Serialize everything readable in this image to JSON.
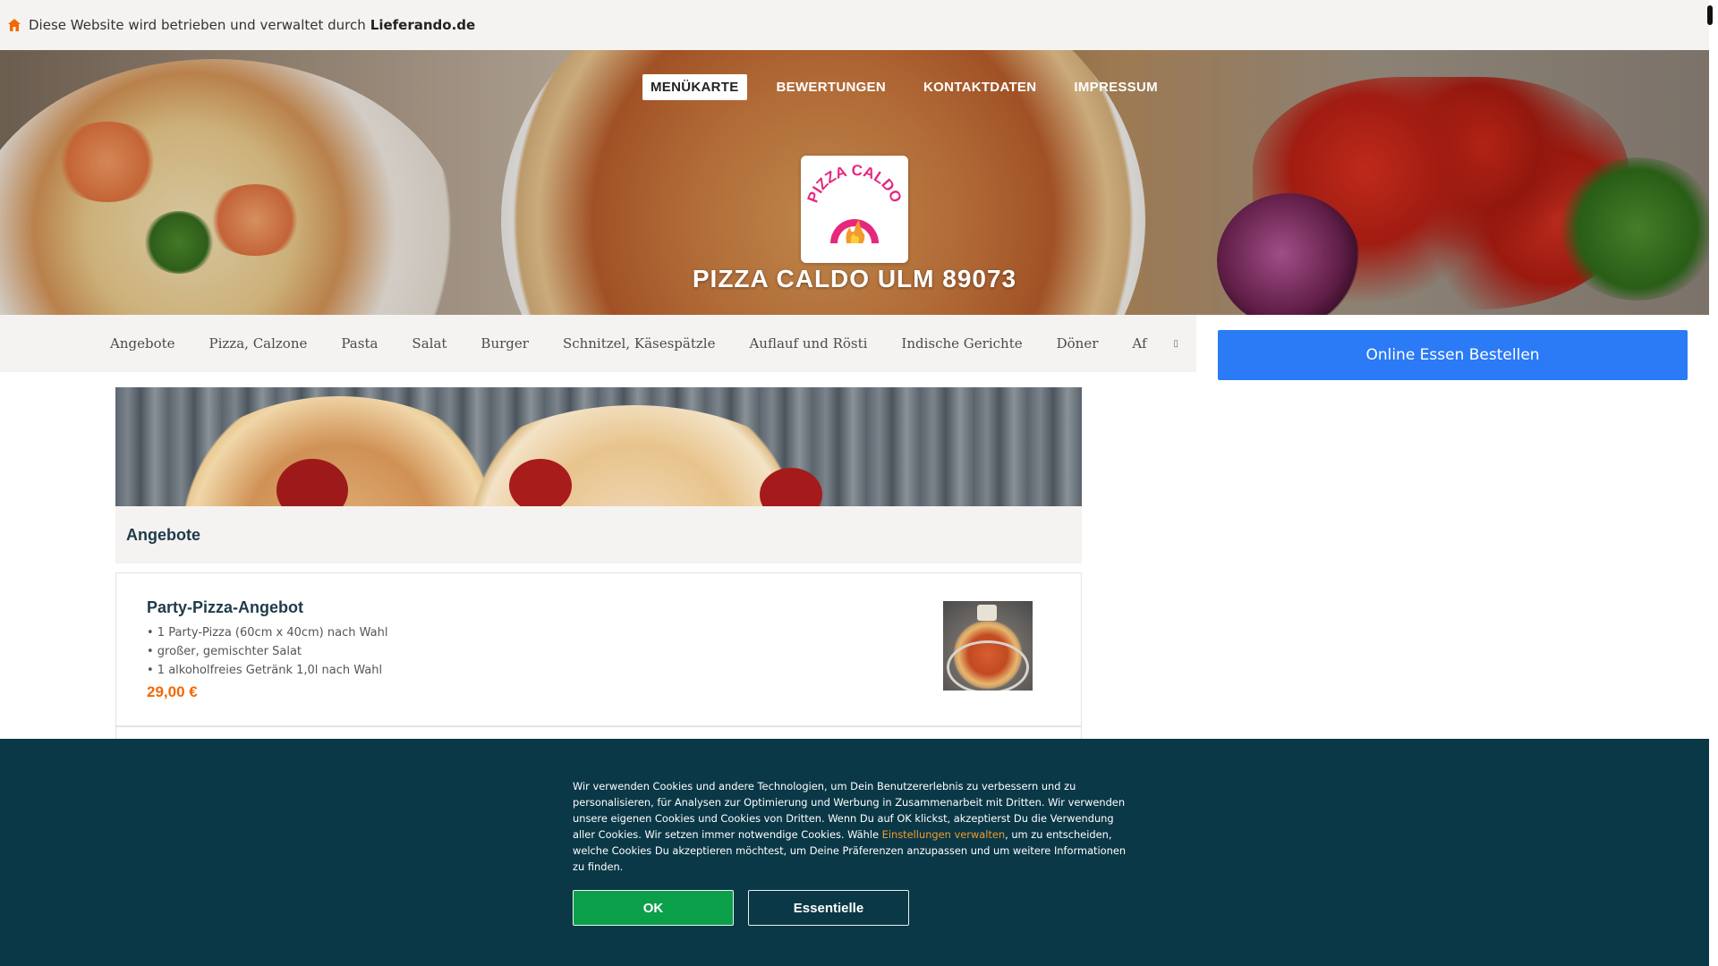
{
  "notice": {
    "prefix": "Diese Website wird betrieben und verwaltet durch",
    "brand": "Lieferando.de",
    "icon": "house-icon"
  },
  "hero": {
    "nav": [
      "MENÜKARTE",
      "BEWERTUNGEN",
      "KONTAKTDATEN",
      "IMPRESSUM"
    ],
    "active_nav": "MENÜKARTE",
    "logo_text": "PIZZA CALDO",
    "title": "PIZZA CALDO ULM 89073"
  },
  "categories": [
    "Angebote",
    "Pizza, Calzone",
    "Pasta",
    "Salat",
    "Burger",
    "Schnitzel, Käsespätzle",
    "Auflauf und Rösti",
    "Indische Gerichte",
    "Döner",
    "Af"
  ],
  "order_button": "Online Essen Bestellen",
  "section": {
    "title": "Angebote",
    "items": [
      {
        "name": "Party-Pizza-Angebot",
        "desc": [
          "• 1 Party-Pizza (60cm x 40cm) nach Wahl",
          "• großer, gemischter Salat",
          "• 1 alkoholfreies Getränk 1,0l nach Wahl"
        ],
        "price": "29,00 €"
      }
    ]
  },
  "cookie": {
    "text_before": "Wir verwenden Cookies und andere Technologien, um Dein Benutzererlebnis zu verbessern und zu personalisieren, für Analysen zur Optimierung und Werbung in Zusammenarbeit mit Dritten. Wir verwenden unsere eigenen Cookies und Cookies von Dritten. Wenn Du auf OK klickst, akzeptierst Du die Verwendung aller Cookies. Wir setzen immer notwendige Cookies. Wähle ",
    "link": "Einstellungen verwalten",
    "text_after": ", um zu entscheiden, welche Cookies Du akzeptieren möchtest, um Deine Präferenzen anzupassen und um weitere Informationen zu finden.",
    "ok": "OK",
    "essential": "Essentielle"
  },
  "colors": {
    "accent_orange": "#f36805",
    "order_blue": "#2b7af6",
    "cookie_bg": "#0a3847",
    "ok_green": "#0c9f4a",
    "logo_pink": "#e6287d"
  }
}
